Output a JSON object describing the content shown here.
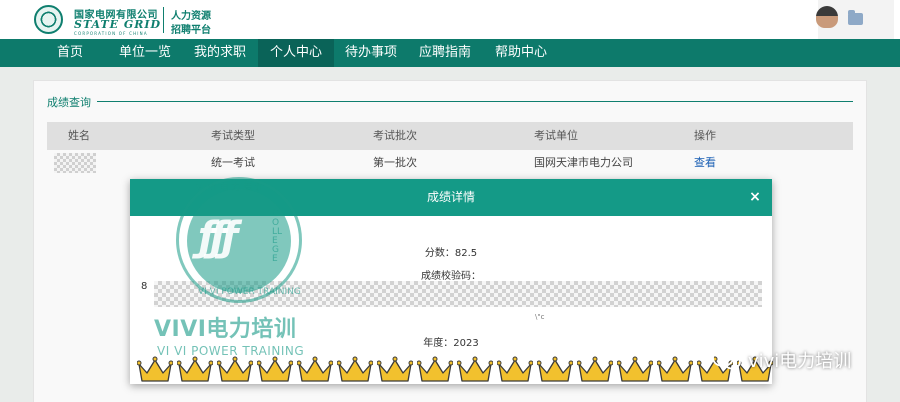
{
  "brand": {
    "name_cn": "国家电网有限公司",
    "name_en": "STATE GRID",
    "name_en_sub": "CORPORATION OF CHINA",
    "portal_line1": "人力资源",
    "portal_line2": "招聘平台"
  },
  "nav": {
    "items": [
      {
        "label": "首页",
        "active": false
      },
      {
        "label": "单位一览",
        "active": false
      },
      {
        "label": "我的求职",
        "active": false
      },
      {
        "label": "个人中心",
        "active": true
      },
      {
        "label": "待办事项",
        "active": false
      },
      {
        "label": "应聘指南",
        "active": false
      },
      {
        "label": "帮助中心",
        "active": false
      }
    ]
  },
  "section": {
    "title": "成绩查询"
  },
  "table": {
    "headers": [
      "姓名",
      "考试类型",
      "考试批次",
      "考试单位",
      "操作"
    ],
    "rows": [
      {
        "name": "",
        "exam_type": "统一考试",
        "batch": "第一批次",
        "unit": "国网天津市电力公司",
        "action": "查看"
      }
    ]
  },
  "modal": {
    "title": "成绩详情",
    "close": "×",
    "score_label": "分数：82.5",
    "code_label": "成绩校验码：",
    "code_prefix": "8",
    "code_tail": "\\\"c",
    "year_label": "年度：2023"
  },
  "watermark": {
    "text": "VIVI电力培训",
    "text_en": "VI VI POWER TRAINING",
    "ring_top": "VI VI 电 力 培 训",
    "ring_right": "COLLEGE",
    "ring_bottom": "VI VI POWER TRAINING"
  },
  "wechat_badge": {
    "text": "vivi电力培训"
  },
  "icons": {
    "logo": "state-grid-logo-icon",
    "avatar": "user-avatar-icon",
    "folder": "folder-icon",
    "close": "close-icon",
    "crown": "crown-icon",
    "wechat": "wechat-icon"
  },
  "colors": {
    "brand_green": "#0d7a6b",
    "modal_header": "#149a87",
    "link_blue": "#1a5fb4",
    "crown_gold": "#f2c12e"
  }
}
